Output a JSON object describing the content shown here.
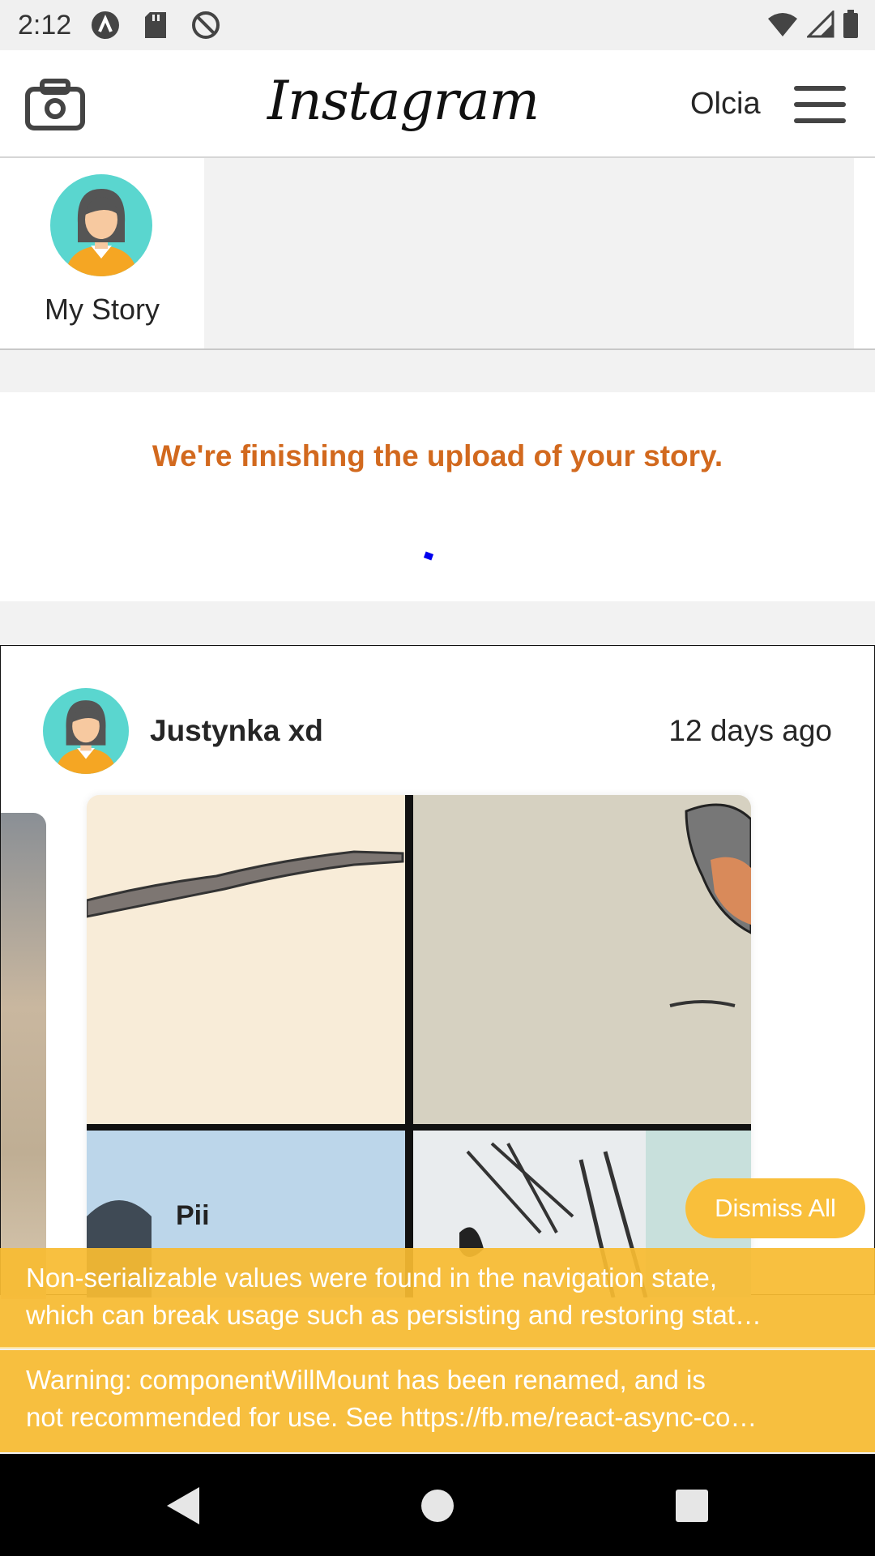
{
  "status_bar": {
    "time": "2:12",
    "left_icons": [
      "a-logo-icon",
      "sd-card-icon",
      "no-sync-icon"
    ],
    "right_icons": [
      "wifi-icon",
      "signal-icon",
      "battery-icon"
    ]
  },
  "header": {
    "logo_text": "Instagram",
    "username": "Olcia",
    "camera_icon": "camera-icon",
    "menu_icon": "hamburger-menu-icon"
  },
  "stories": {
    "my_story_label": "My Story"
  },
  "upload_banner": {
    "message": "We're finishing the upload of your story."
  },
  "post": {
    "author": "Justynka xd",
    "time": "12 days ago"
  },
  "warnings": {
    "dismiss_label": "Dismiss All",
    "items": [
      {
        "line1": "Non-serializable values were found in the navigation state,",
        "line2": "which can break usage such as persisting and restoring stat…"
      },
      {
        "line1": "Warning: componentWillMount has been renamed, and is",
        "line2": "not recommended for use. See https://fb.me/react-async-co…"
      }
    ]
  },
  "colors": {
    "accent_orange": "#d2691e",
    "warning_yellow": "#f8bb31",
    "avatar_bg": "#5ad6cf"
  }
}
